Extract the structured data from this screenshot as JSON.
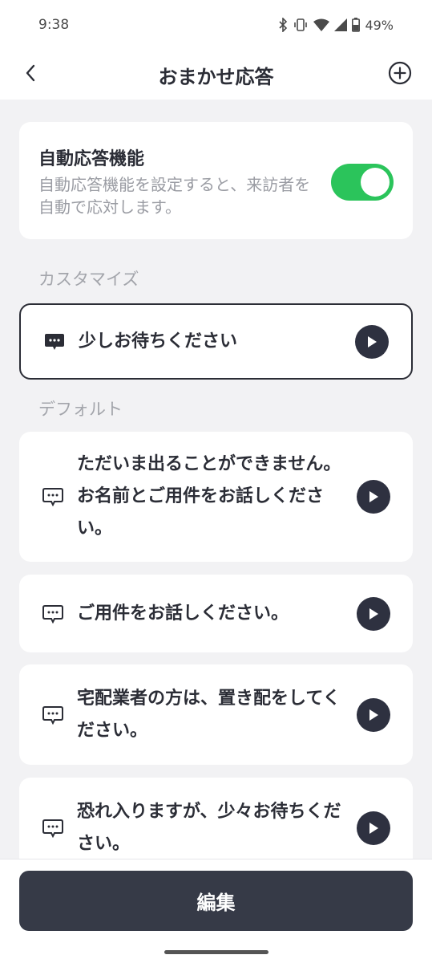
{
  "status_bar": {
    "time": "9:38",
    "battery": "49%"
  },
  "header": {
    "title": "おまかせ応答"
  },
  "auto_response": {
    "title": "自動応答機能",
    "description": "自動応答機能を設定すると、来訪者を自動で応対します。",
    "enabled": true,
    "toggle_color": "#2bc45b"
  },
  "sections": {
    "custom_label": "カスタマイズ",
    "default_label": "デフォルト"
  },
  "custom_messages": [
    {
      "text": "少しお待ちください"
    }
  ],
  "default_messages": [
    {
      "text": "ただいま出ることができません。お名前とご用件をお話しください。"
    },
    {
      "text": "ご用件をお話しください。"
    },
    {
      "text": "宅配業者の方は、置き配をしてください。"
    },
    {
      "text": "恐れ入りますが、少々お待ちください。"
    }
  ],
  "footer": {
    "edit_label": "編集"
  }
}
